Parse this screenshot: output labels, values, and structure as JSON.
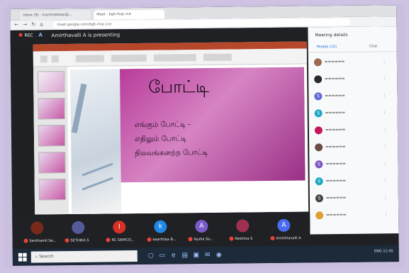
{
  "browser": {
    "tabs": [
      {
        "label": "Inbox (9) - manimekalai@..."
      },
      {
        "label": "Meet - bgh-rkqc-ice"
      }
    ],
    "url": "meet.google.com/bgh-rkqc-ice"
  },
  "meet": {
    "rec_label": "REC",
    "presenter_initial": "A",
    "presenting_text": "Amirthavalli A is presenting"
  },
  "slide": {
    "title": "போட்டி",
    "lines": [
      "எங்கும் போட்டி -",
      "எதிலும் போட்டி",
      "நிலவங்கனற்ற போட்டி"
    ]
  },
  "panel": {
    "heading": "Meeting details",
    "people_tab": "People (10)",
    "chat_tab": "Chat",
    "people": [
      {
        "initial": "",
        "color": "#9b6a4f"
      },
      {
        "initial": "",
        "color": "#2b2b2b"
      },
      {
        "initial": "S",
        "color": "#5e6ad2"
      },
      {
        "initial": "S",
        "color": "#1ea7c5"
      },
      {
        "initial": "",
        "color": "#c2185b"
      },
      {
        "initial": "",
        "color": "#6d4c41"
      },
      {
        "initial": "S",
        "color": "#7e57c2"
      },
      {
        "initial": "S",
        "color": "#1ea7c5"
      },
      {
        "initial": "S",
        "color": "#444444"
      },
      {
        "initial": "",
        "color": "#e0a030"
      }
    ]
  },
  "participants": [
    {
      "initial": "",
      "name": "Senthamil Se...",
      "color": "#7a2a1a"
    },
    {
      "initial": "",
      "name": "SETHIKA S",
      "color": "#555b9a"
    },
    {
      "initial": "I",
      "name": "RC GKMCO...",
      "color": "#d93025"
    },
    {
      "initial": "k",
      "name": "keerthika B...",
      "color": "#1e88e5"
    },
    {
      "initial": "A",
      "name": "Aysha Sa...",
      "color": "#7b5ac9"
    },
    {
      "initial": "",
      "name": "Reshma S",
      "color": "#a03050"
    },
    {
      "initial": "A",
      "name": "Amirthavalli A",
      "color": "#4a6cf0"
    }
  ],
  "taskbar": {
    "search_text": "Search",
    "tray_text": "ENG 11:45"
  }
}
